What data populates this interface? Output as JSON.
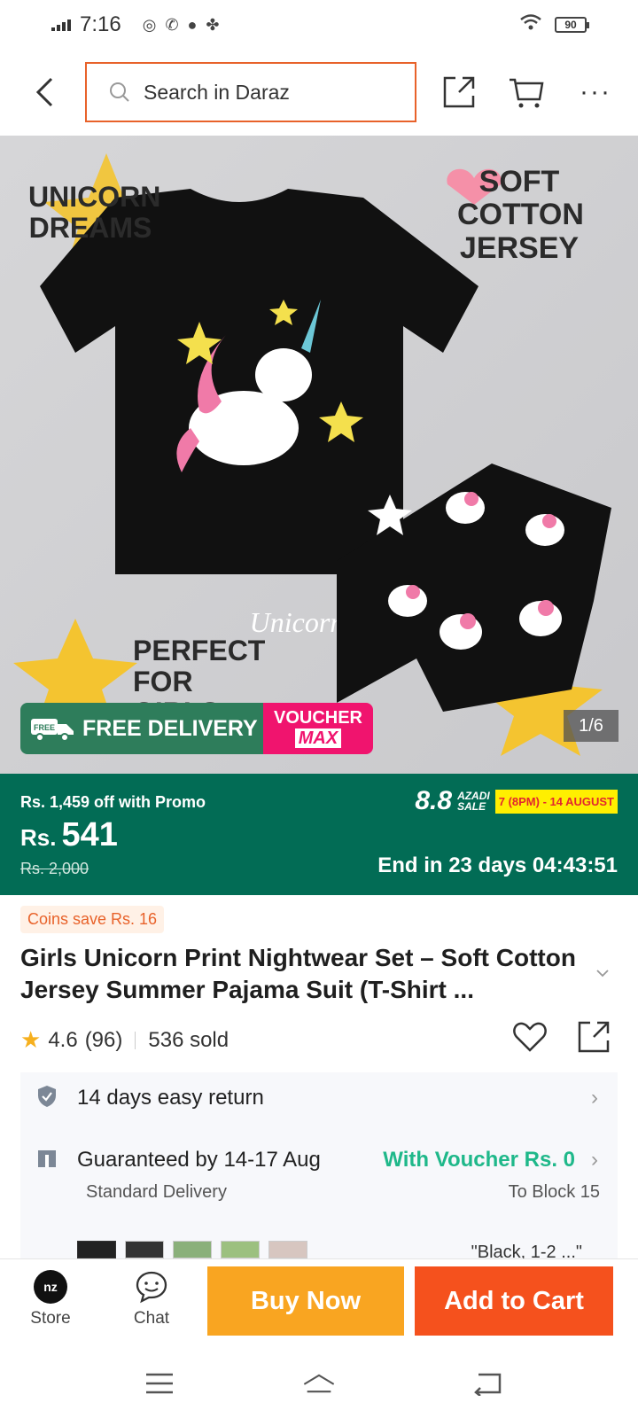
{
  "status_bar": {
    "time": "7:16",
    "battery": "90"
  },
  "header": {
    "search_placeholder": "Search in Daraz"
  },
  "hero": {
    "badge_unicorn": "UNICORN DREAMS",
    "badge_cotton": "SOFT COTTON JERSEY",
    "badge_girls": "PERFECT FOR GIRLS",
    "shirt_text": "Unicorn",
    "free_delivery_tag": "FREE",
    "free_delivery": "FREE DELIVERY",
    "voucher_top": "VOUCHER",
    "voucher_bottom": "MAX",
    "slide_counter": "1/6"
  },
  "price": {
    "promo_off": "Rs. 1,459 off with Promo",
    "currency": "Rs.",
    "current": "541",
    "original": "Rs. 2,000",
    "campaign_big": "8.8",
    "campaign_small_1": "AZADI",
    "campaign_small_2": "SALE",
    "campaign_date": "7 (8PM) - 14 AUGUST",
    "countdown": "End in 23 days 04:43:51"
  },
  "product": {
    "coins": "Coins save Rs. 16",
    "title": "Girls Unicorn Print Nightwear Set – Soft Cotton Jersey Summer Pajama Suit (T-Shirt ...",
    "rating": "4.6",
    "reviews": "(96)",
    "sold": "536 sold"
  },
  "services": {
    "return_label": "14 days easy return",
    "delivery_label": "Guaranteed by 14-17 Aug",
    "delivery_voucher": "With Voucher Rs. 0",
    "delivery_type": "Standard Delivery",
    "delivery_to": "To Block 15",
    "variant_label": "\"Black, 1-2 ...\""
  },
  "bottom_bar": {
    "store_logo": "nz",
    "store": "Store",
    "chat": "Chat",
    "buy_now": "Buy Now",
    "add_to_cart": "Add to Cart"
  },
  "colors": {
    "brand_orange": "#f5511d",
    "buy_yellow": "#f9a521",
    "price_green": "#026c55",
    "voucher_pink": "#f0146e"
  }
}
